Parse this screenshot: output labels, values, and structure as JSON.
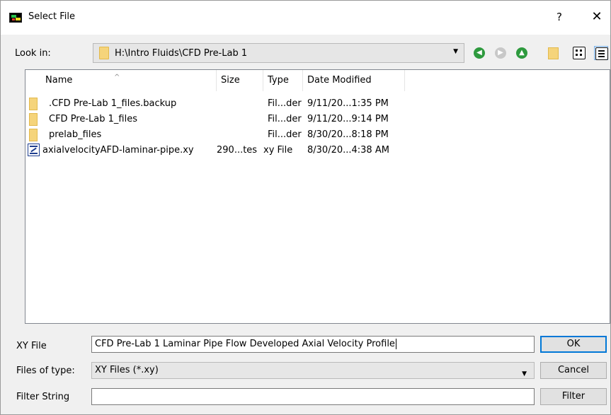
{
  "window": {
    "title": "Select File",
    "help_label": "?",
    "close_label": "✕"
  },
  "lookin": {
    "label": "Look in:",
    "path": "H:\\Intro Fluids\\CFD Pre-Lab 1",
    "arrow": "▼"
  },
  "toolbar": {
    "back_glyph": "◀",
    "forward_glyph": "▶",
    "up_glyph": "▲",
    "icons": [
      "back-icon",
      "forward-icon",
      "up-folder-icon",
      "new-folder-icon",
      "list-view-icon",
      "detail-view-icon"
    ]
  },
  "filelist": {
    "columns": [
      "Name",
      "Size",
      "Type",
      "Date Modified"
    ],
    "sort_indicator": "^",
    "rows": [
      {
        "name": ".CFD Pre-Lab 1_files.backup",
        "size": "",
        "type": "Fil...der",
        "date": "9/11/20...1:35 PM",
        "icon": "folder-icon"
      },
      {
        "name": "CFD Pre-Lab 1_files",
        "size": "",
        "type": "Fil...der",
        "date": "9/11/20...9:14 PM",
        "icon": "folder-icon"
      },
      {
        "name": "prelab_files",
        "size": "",
        "type": "Fil...der",
        "date": "8/30/20...8:18 PM",
        "icon": "folder-icon"
      },
      {
        "name": "axialvelocityAFD-laminar-pipe.xy",
        "size": "290...tes",
        "type": "xy File",
        "date": "8/30/20...4:38 AM",
        "icon": "xy-file-icon"
      }
    ]
  },
  "form": {
    "filename_label": "XY File",
    "filename_value": "CFD Pre-Lab 1 Laminar Pipe Flow Developed Axial Velocity Profile",
    "filetype_label": "Files of type:",
    "filetype_value": "XY Files (*.xy)",
    "filter_label": "Filter String",
    "filter_value": ""
  },
  "buttons": {
    "ok": "OK",
    "cancel": "Cancel",
    "filter": "Filter"
  },
  "colors": {
    "accent": "#0078d7",
    "folder": "#f5d47b",
    "nav_green": "#2e9a3e"
  }
}
